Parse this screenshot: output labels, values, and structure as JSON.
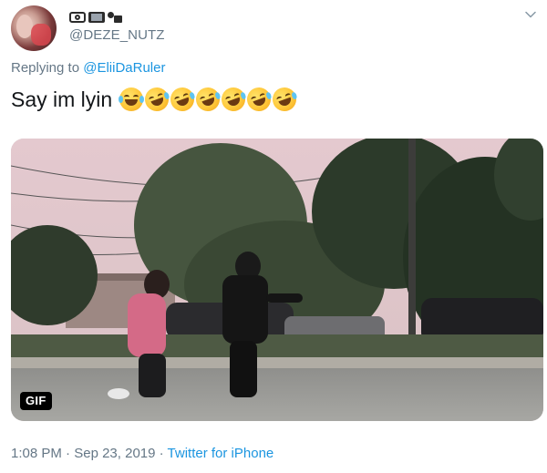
{
  "user": {
    "display_emojis": [
      "camera-with-flash-icon",
      "television-icon",
      "movie-camera-icon"
    ],
    "handle": "@DEZE_NUTZ"
  },
  "reply": {
    "prefix": "Replying to ",
    "mention": "@EliiDaRuler"
  },
  "tweet": {
    "text": "Say im lyin",
    "emojis": [
      "face-with-tears-of-joy-icon",
      "rolling-on-the-floor-laughing-icon",
      "rolling-on-the-floor-laughing-icon",
      "rolling-on-the-floor-laughing-icon",
      "rolling-on-the-floor-laughing-icon",
      "rolling-on-the-floor-laughing-icon",
      "rolling-on-the-floor-laughing-icon"
    ]
  },
  "media": {
    "badge": "GIF"
  },
  "meta": {
    "time": "1:08 PM",
    "separator": " · ",
    "date": "Sep 23, 2019",
    "source": "Twitter for iPhone"
  },
  "colors": {
    "link": "#1b95e0",
    "secondary_text": "#657786",
    "primary_text": "#14171a"
  }
}
